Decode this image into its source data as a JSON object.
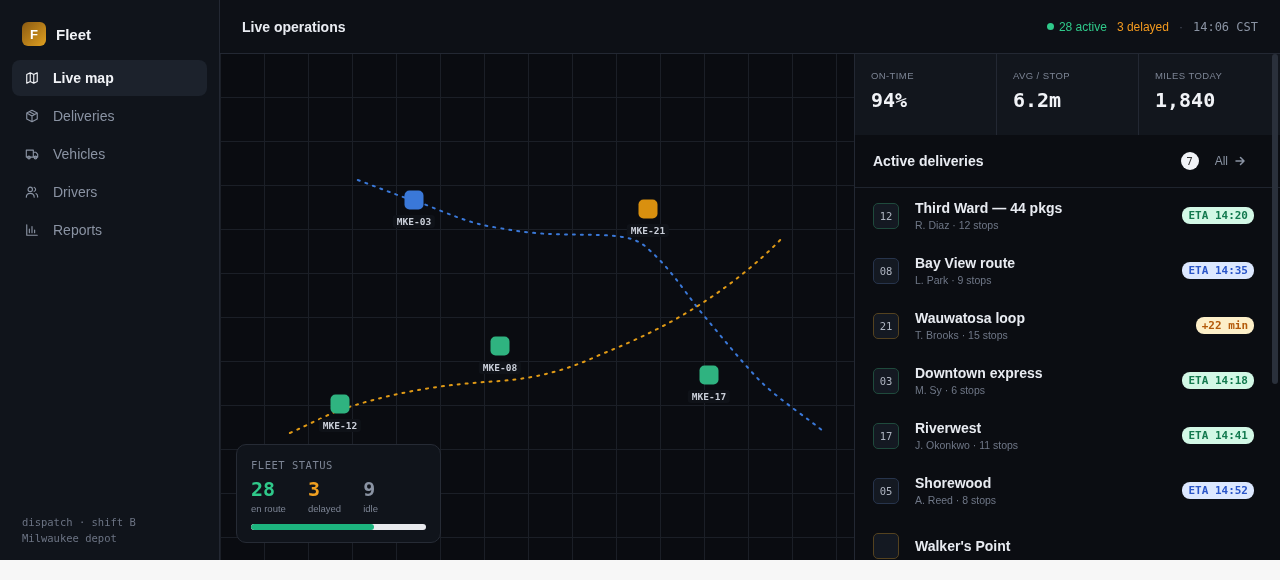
{
  "brand": {
    "logo_letter": "F",
    "name": "Fleet"
  },
  "sidebar": {
    "items": [
      {
        "label": "Live map",
        "selected": true
      },
      {
        "label": "Deliveries",
        "selected": false
      },
      {
        "label": "Vehicles",
        "selected": false
      },
      {
        "label": "Drivers",
        "selected": false
      },
      {
        "label": "Reports",
        "selected": false
      }
    ],
    "footer": [
      "dispatch · shift B",
      "Milwaukee depot"
    ]
  },
  "header": {
    "title": "Live operations",
    "active": "28 active",
    "delayed": "3 delayed",
    "separator": "·",
    "time": "14:06 CST"
  },
  "map": {
    "vehicles": [
      {
        "label": "MKE-03",
        "color": "#3a78d8"
      },
      {
        "label": "MKE-21",
        "color": "#d9900f"
      },
      {
        "label": "MKE-08",
        "color": "#2fb380"
      },
      {
        "label": "MKE-17",
        "color": "#2fb380"
      },
      {
        "label": "MKE-12",
        "color": "#2fb380"
      }
    ],
    "fleet_status": {
      "title": "FLEET STATUS",
      "counts": [
        {
          "value": "28",
          "label": "en route",
          "kind": "ok"
        },
        {
          "value": "3",
          "label": "delayed",
          "kind": "late"
        },
        {
          "value": "9",
          "label": "idle",
          "kind": "idle"
        }
      ],
      "level": 0.7
    }
  },
  "stats": [
    {
      "label": "ON-TIME",
      "value": "94%"
    },
    {
      "label": "AVG / STOP",
      "value": "6.2m"
    },
    {
      "label": "MILES TODAY",
      "value": "1,840"
    }
  ],
  "deliveries": {
    "title": "Active deliveries",
    "count": "7",
    "link": "All",
    "items": [
      {
        "number": "12",
        "title": "Third Ward — 44 pkgs",
        "meta": "R. Diaz · 12 stops",
        "badge": "ETA 14:20",
        "kind": "ontime"
      },
      {
        "number": "08",
        "title": "Bay View route",
        "meta": "L. Park · 9 stops",
        "badge": "ETA 14:35",
        "kind": "planned"
      },
      {
        "number": "21",
        "title": "Wauwatosa loop",
        "meta": "T. Brooks · 15 stops",
        "badge": "+22 min",
        "kind": "late"
      },
      {
        "number": "03",
        "title": "Downtown express",
        "meta": "M. Sy · 6 stops",
        "badge": "ETA 14:18",
        "kind": "ontime"
      },
      {
        "number": "17",
        "title": "Riverwest",
        "meta": "J. Okonkwo · 11 stops",
        "badge": "ETA 14:41",
        "kind": "ontime"
      },
      {
        "number": "05",
        "title": "Shorewood",
        "meta": "A. Reed · 8 stops",
        "badge": "ETA 14:52",
        "kind": "planned"
      },
      {
        "title": "Walker's Point",
        "kind": "late"
      }
    ]
  }
}
